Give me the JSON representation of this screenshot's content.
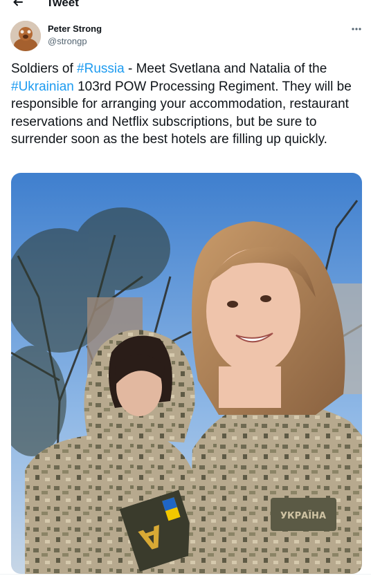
{
  "topbar": {
    "title": "Tweet",
    "back_icon": "arrow-left-icon"
  },
  "tweet": {
    "author_name": "Peter Strong",
    "author_handle": "@strongp",
    "more_icon": "more-horizontal-icon",
    "text_parts": [
      "Soldiers of ",
      "#Russia",
      " - Meet Svetlana and Natalia of the ",
      "#Ukrainian",
      " 103rd POW Processing Regiment. They will be responsible for arranging your accommodation, restaurant reservations and Netflix subscriptions, but be sure to surrender soon as the best hotels are filling up quickly."
    ],
    "media": {
      "patch_text": "УКРАЇНА"
    }
  },
  "colors": {
    "text": "#0f1419",
    "secondary": "#536471",
    "link": "#1d9bf0",
    "divider": "#eff3f4"
  }
}
